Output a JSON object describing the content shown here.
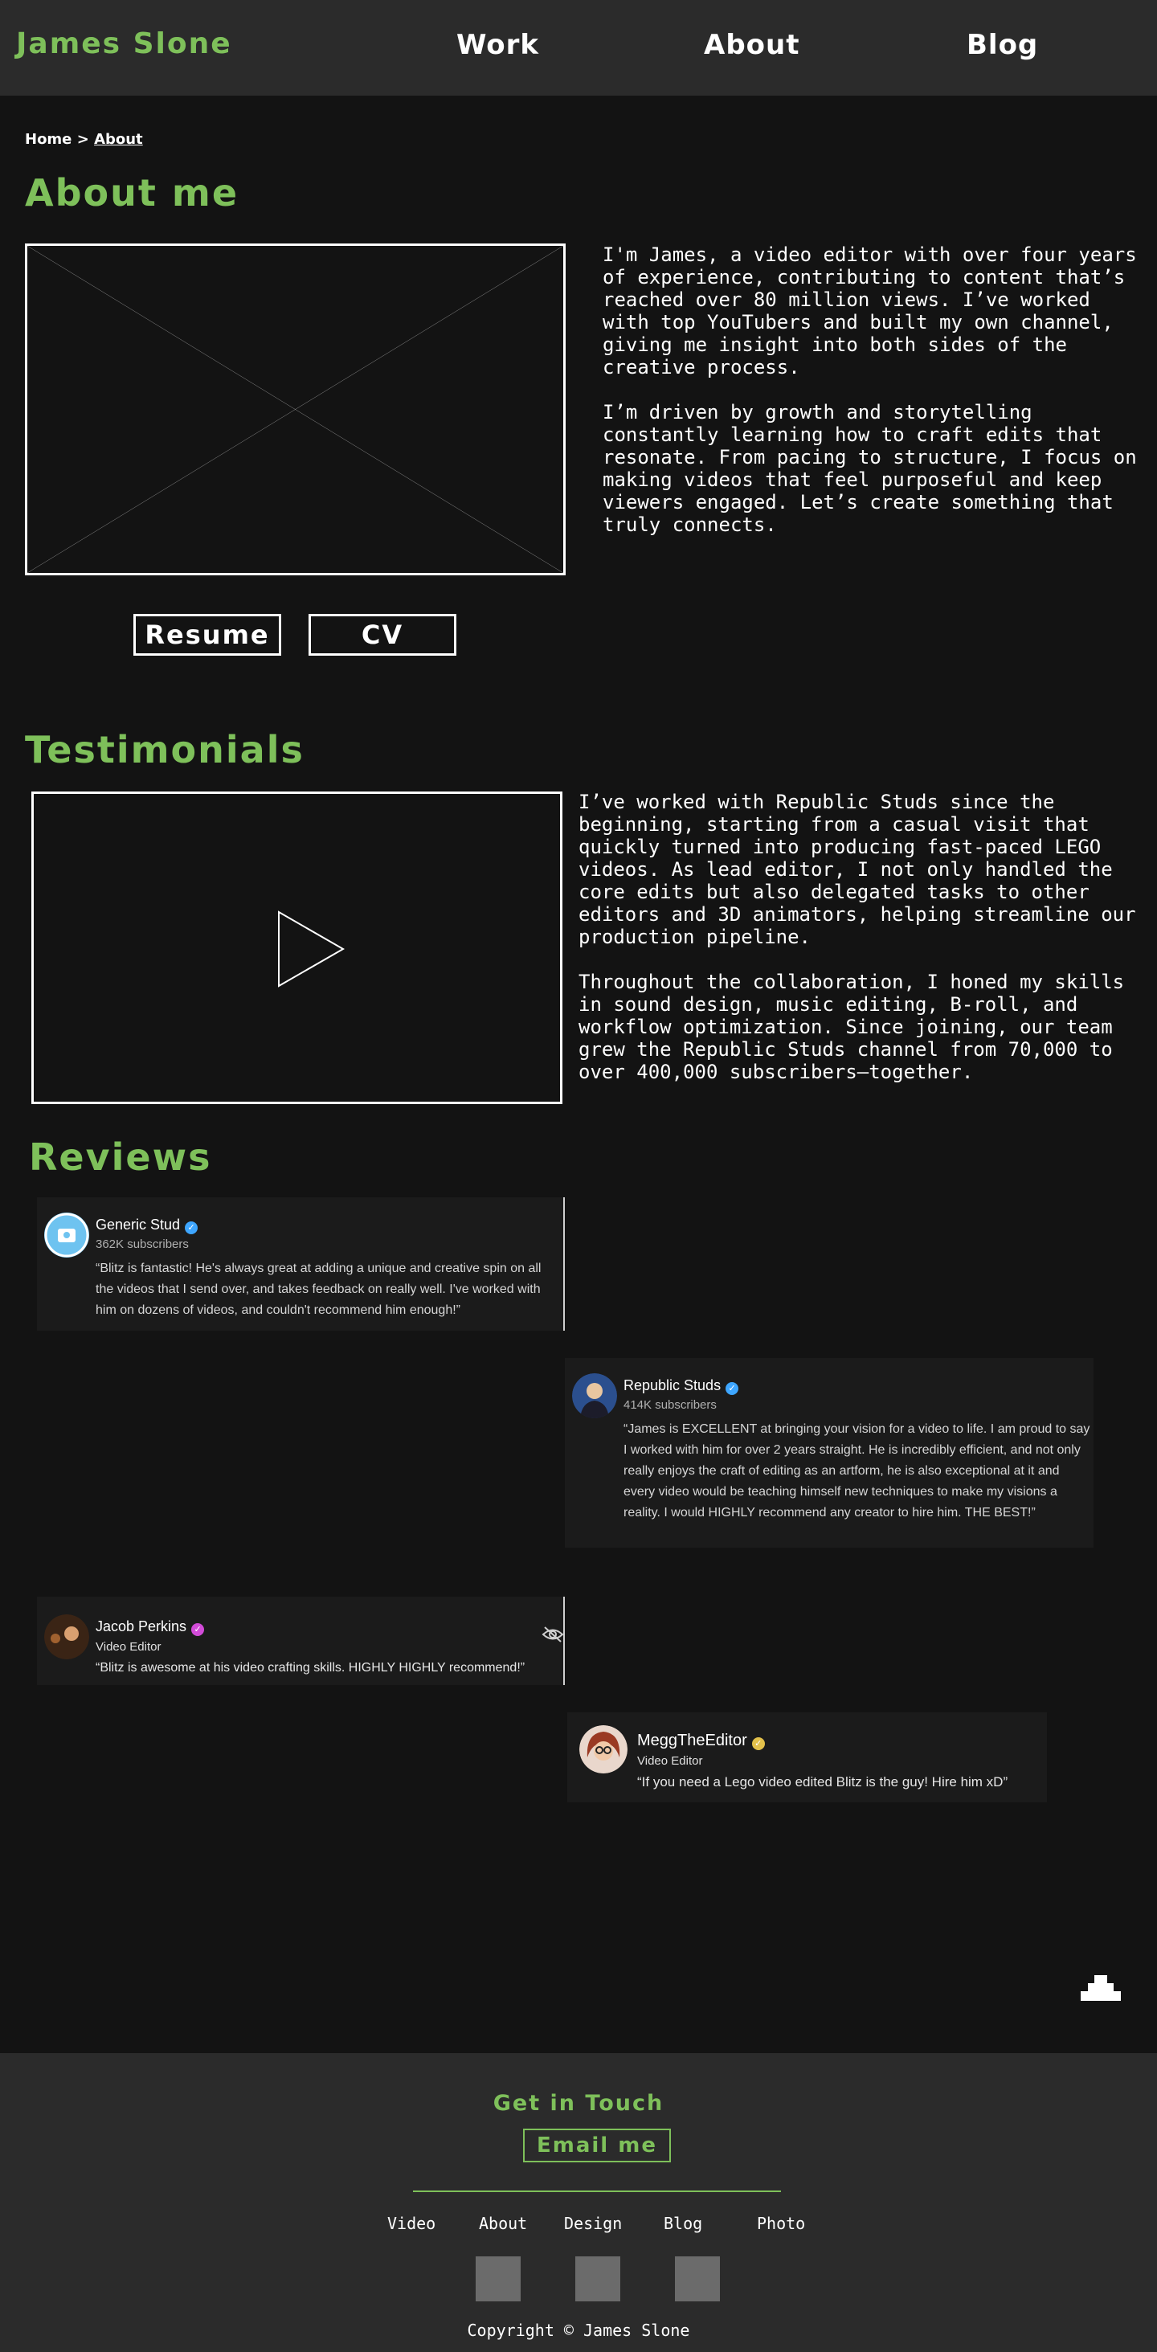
{
  "header": {
    "brand": "James Slone",
    "nav": [
      "Work",
      "About",
      "Blog"
    ]
  },
  "breadcrumb": {
    "home": "Home",
    "separator": ">",
    "current": "About"
  },
  "about": {
    "title": "About me",
    "paragraphs": [
      "I'm James, a video editor with over four years of experience, contributing to content that’s reached over 80 million views. I’ve worked with top YouTubers and built my own channel, giving me insight into both sides of the creative process.",
      "I’m driven by growth and storytelling constantly learning how to craft edits that resonate. From pacing to structure, I focus on making videos that feel purposeful and keep viewers engaged. Let’s create something that truly connects."
    ],
    "buttons": {
      "resume": "Resume",
      "cv": "CV"
    }
  },
  "testimonials": {
    "title": "Testimonials",
    "paragraphs": [
      "I’ve worked with Republic Studs since the beginning, starting from a casual visit that quickly turned into producing fast-paced LEGO videos. As lead editor, I not only handled the core edits but also delegated tasks to other editors and 3D animators, helping streamline our production pipeline.",
      "Throughout the collaboration, I honed my skills in sound design, music editing, B-roll, and workflow optimization. Since joining, our team grew the Republic Studs channel from 70,000 to over 400,000 subscribers—together."
    ]
  },
  "reviews": {
    "title": "Reviews",
    "items": [
      {
        "name": "Generic Stud",
        "subtitle": "362K subscribers",
        "text": "“Blitz is fantastic! He's always great at adding a unique and creative spin on all the videos that I send over, and takes feedback on really well. I've worked with him on dozens of videos, and couldn't recommend him enough!”"
      },
      {
        "name": "Republic Studs",
        "subtitle": "414K subscribers",
        "text": "“James is EXCELLENT at bringing your vision for a video to life. I am proud to say I worked with him for over 2 years straight. He is incredibly efficient, and not only really enjoys the craft of editing as an artform, he is also exceptional at it and every video would be teaching himself new techniques to make my visions a reality. I would HIGHLY recommend any creator to hire him. THE BEST!”"
      },
      {
        "name": "Jacob Perkins",
        "subtitle": "Video Editor",
        "text": "“Blitz is awesome at his video crafting skills. HIGHLY HIGHLY recommend!”"
      },
      {
        "name": "MeggTheEditor",
        "subtitle": "Video Editor",
        "text": "“If you need a Lego video edited Blitz is the guy! Hire him xD”"
      }
    ]
  },
  "footer": {
    "title": "Get in Touch",
    "email_button": "Email me",
    "links": [
      "Video",
      "About",
      "Design",
      "Blog",
      "Photo"
    ],
    "copyright": "Copyright © James Slone"
  },
  "colors": {
    "accent": "#7ec05a",
    "background": "#131313",
    "panel": "#2b2b2b",
    "card": "#1b1b1b"
  },
  "icons": [
    "verified-badge-icon",
    "play-icon",
    "eye-off-icon",
    "scroll-top-icon"
  ]
}
